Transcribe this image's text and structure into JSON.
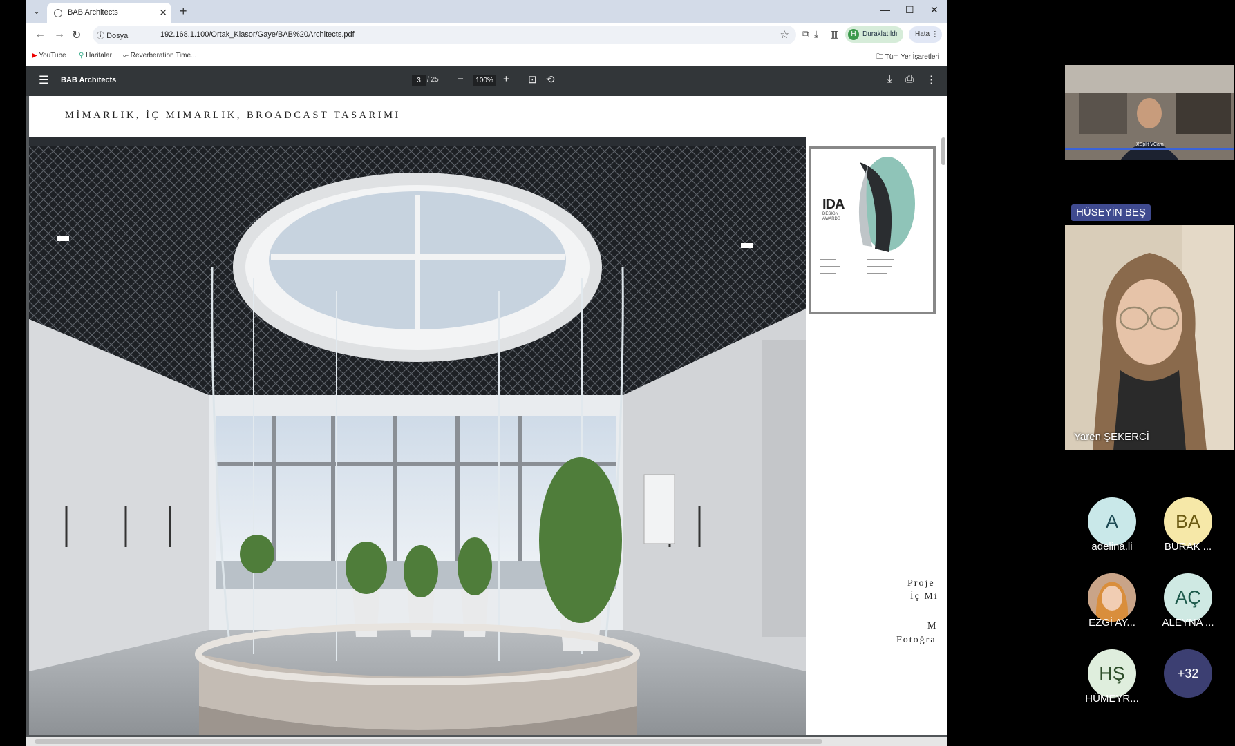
{
  "browser": {
    "tab_title": "BAB Architects",
    "info_chip": "Dosya",
    "url": "192.168.1.100/Ortak_Klasor/Gaye/BAB%20Architects.pdf",
    "profile_initial": "H",
    "profile_label": "Duraklatıldı",
    "error_label": "Hata",
    "bookmarks": [
      "YouTube",
      "Haritalar",
      "Reverberation Time..."
    ],
    "all_bookmarks": "Tüm Yer İşaretleri"
  },
  "pdf": {
    "title": "BAB Architects",
    "current_page": "3",
    "total_pages": "/ 25",
    "zoom": "100%",
    "heading": "MİMARLIK, İÇ MIMARLIK, BROADCAST TASARIMI",
    "cert_logo": "IDA",
    "cert_sub": "DESIGN AWARDS",
    "project_lines": [
      "Proje",
      "İç Mi",
      "M",
      "Fotoğra"
    ]
  },
  "meeting": {
    "presenter_label": "XSplit VCam",
    "speaker_tag": "HÜSEYİN BEŞ",
    "speaker_name": "Yaren ŞEKERCİ",
    "participants": [
      {
        "initials": "A",
        "name": "adelina.li",
        "bg": "#c9e8e9",
        "fg": "#1e4b55"
      },
      {
        "initials": "BA",
        "name": "BURAK ...",
        "bg": "#f6e8a8",
        "fg": "#6b5a12"
      },
      {
        "initials": "",
        "name": "EZGİ AY...",
        "bg": "#b08a6e",
        "fg": "#fff"
      },
      {
        "initials": "AÇ",
        "name": "ALEYNA ...",
        "bg": "#cfe9e3",
        "fg": "#1e5a4c"
      },
      {
        "initials": "HŞ",
        "name": "HÜMEYR...",
        "bg": "#dfeedd",
        "fg": "#2d4e2a"
      },
      {
        "initials": "+32",
        "name": "",
        "bg": "#3c3f72",
        "fg": "#fff"
      }
    ]
  }
}
